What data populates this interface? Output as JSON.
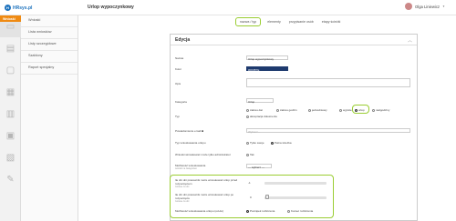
{
  "app": {
    "logo_text": "HRsys.pl",
    "page_title": "Urlop wypoczynkowy",
    "user_name": "Olga Liniewicz"
  },
  "sidebar": {
    "section_label": "Wnioski",
    "menu": [
      {
        "label": "Wnioski"
      },
      {
        "label": "Lista wniosków"
      },
      {
        "label": "Listy szczegółowe"
      },
      {
        "label": "Szablony"
      },
      {
        "label": "Raport specjalny"
      }
    ]
  },
  "tabs": [
    {
      "label": "nazwa / typ",
      "active": true
    },
    {
      "label": "elementy",
      "active": false
    },
    {
      "label": "przypisanie osób",
      "active": false
    },
    {
      "label": "etapy ścieżki",
      "active": false
    }
  ],
  "edit": {
    "title": "Edycja",
    "fields": {
      "nazwa_label": "Nazwa",
      "nazwa_value": "Urlop wypoczynkowy",
      "kolor_label": "Kolor",
      "kolor_value": "#003B7E",
      "opis_label": "Opis",
      "kategoria_label": "Kategoria",
      "kategoria_value": "Urlop",
      "typ_label": "Typ",
      "typ_options": [
        {
          "label": "zakres dat",
          "selected": false
        },
        {
          "label": "zakres godzin",
          "selected": false
        },
        {
          "label": "jednodniowy",
          "selected": false
        },
        {
          "label": "wyjście",
          "selected": false
        },
        {
          "label": "urlop",
          "selected": true
        },
        {
          "label": "nadgodziny",
          "selected": false
        },
        {
          "label": "akceptacja dokumentu",
          "selected": false
        }
      ],
      "powiadomienie_label": "Powiadomienie email",
      "powiadomienie_placeholder": "Wybierz...",
      "typ_wnioskowania_label": "Typ wnioskowania urlopu",
      "typ_wnioskowania_options": [
        {
          "label": "Tylko swoje",
          "selected": false
        },
        {
          "label": "Pełna ścieżka",
          "selected": true
        }
      ],
      "admin_only_label": "Wnioski wnioskować może tylko administrator",
      "admin_only_option": "Tak",
      "mozliwosc_label": "Możliwość wnioskowania",
      "mozliwosc_sub": "wnioski na zastępstwo",
      "mozliwosc_value": "--- wybierz ---",
      "ile_dni_przed_label": "Ile dni dni pracownik może wnioskować urlop przed rozpoczęciem",
      "ile_dni_przed_sub": "Gotowe za dni",
      "ile_dni_przed_value": "-1",
      "ile_dni_po_label": "Ile dni dni pracownik może wnioskować urlop po rozpoczęciu",
      "ile_dni_po_sub": "Gotowe za dni",
      "ile_dni_po_value": "0",
      "ile_dni_po_fill": 0.05,
      "mozliwosc_wn_label": "Możliwość wnioskowania urlopu (od-do)",
      "mozliwosc_wn_options": [
        {
          "label": "Początek rozliczenia",
          "selected": true
        },
        {
          "label": "Koniec rozliczenia",
          "selected": false
        }
      ]
    }
  }
}
